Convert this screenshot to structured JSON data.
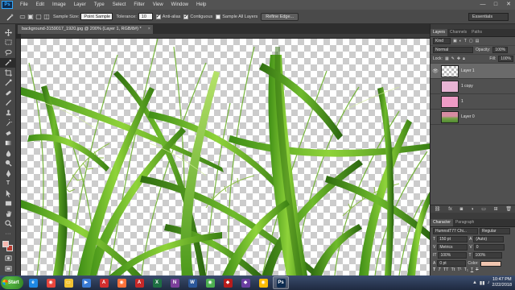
{
  "app": {
    "logo": "Ps",
    "menus": [
      "File",
      "Edit",
      "Image",
      "Layer",
      "Type",
      "Select",
      "Filter",
      "View",
      "Window",
      "Help"
    ],
    "window_controls": [
      "—",
      "□",
      "✕"
    ]
  },
  "options": {
    "sample_size_label": "Sample Size:",
    "sample_size_value": "Point Sample",
    "tolerance_label": "Tolerance:",
    "tolerance_value": "10",
    "anti_alias_label": "Anti-alias",
    "anti_alias_checked": true,
    "contiguous_label": "Contiguous",
    "contiguous_checked": true,
    "sample_all_layers_label": "Sample All Layers",
    "sample_all_layers_checked": false,
    "refine_edge_label": "Refine Edge...",
    "workspace": "Essentials"
  },
  "document": {
    "tab_title": "background-3159017_1920.jpg @ 200% (Layer 1, RGB/8#) *",
    "close": "×"
  },
  "layers_panel": {
    "tabs": [
      "Layers",
      "Channels",
      "Paths"
    ],
    "active_tab": "Layers",
    "kind_label": "Kind",
    "blend_mode": "Normal",
    "opacity_label": "Opacity:",
    "opacity_value": "100%",
    "lock_label": "Lock:",
    "fill_label": "Fill:",
    "fill_value": "100%",
    "layers": [
      {
        "name": "Layer 1",
        "visible": true,
        "selected": true,
        "thumb": "checker"
      },
      {
        "name": "1 copy",
        "visible": false,
        "selected": false,
        "thumb": "pink"
      },
      {
        "name": "1",
        "visible": false,
        "selected": false,
        "thumb": "pink2"
      },
      {
        "name": "Layer 0",
        "visible": false,
        "selected": false,
        "thumb": "flower"
      }
    ],
    "footer_icons": [
      "link-icon",
      "fx-icon",
      "mask-icon",
      "adjustment-icon",
      "folder-icon",
      "new-layer-icon",
      "trash-icon"
    ]
  },
  "character_panel": {
    "tabs": [
      "Character",
      "Paragraph"
    ],
    "font_family": "HumnstT77 Chi...",
    "font_style": "Regular",
    "font_size": "150 pt",
    "leading": "(Auto)",
    "kerning": "Metrics",
    "tracking": "0",
    "vertical_scale": "100%",
    "horizontal_scale": "100%",
    "baseline_shift": "0 pt",
    "color_label": "Color:",
    "color_value": "#f1c6b0",
    "style_buttons": [
      "T",
      "T",
      "TT",
      "Tt",
      "T¹",
      "T₁",
      "T",
      "T"
    ]
  },
  "taskbar": {
    "start_label": "Start",
    "apps": [
      {
        "name": "ie-icon",
        "color": "#1e88e5",
        "glyph": "e"
      },
      {
        "name": "chrome-icon",
        "color": "#e8453c",
        "glyph": "◉"
      },
      {
        "name": "explorer-icon",
        "color": "#f1c232",
        "glyph": "▭"
      },
      {
        "name": "media-player-icon",
        "color": "#3a7bd5",
        "glyph": "▶"
      },
      {
        "name": "acrobat-icon",
        "color": "#d32f2f",
        "glyph": "A"
      },
      {
        "name": "firefox-icon",
        "color": "#ff7139",
        "glyph": "◉"
      },
      {
        "name": "acrobat2-icon",
        "color": "#c62828",
        "glyph": "A"
      },
      {
        "name": "excel-icon",
        "color": "#1d6f42",
        "glyph": "X"
      },
      {
        "name": "onenote-icon",
        "color": "#7b3f9a",
        "glyph": "N"
      },
      {
        "name": "word-icon",
        "color": "#2b579a",
        "glyph": "W"
      },
      {
        "name": "chrome2-icon",
        "color": "#4caf50",
        "glyph": "◉"
      },
      {
        "name": "app-red-icon",
        "color": "#b71c1c",
        "glyph": "◆"
      },
      {
        "name": "visual-studio-icon",
        "color": "#6a3ea1",
        "glyph": "◆"
      },
      {
        "name": "chrome3-icon",
        "color": "#fbbc04",
        "glyph": "◉"
      },
      {
        "name": "photoshop-icon",
        "color": "#0d2b4f",
        "glyph": "Ps"
      }
    ],
    "time": "10:47 PM",
    "date": "2/22/2018"
  }
}
